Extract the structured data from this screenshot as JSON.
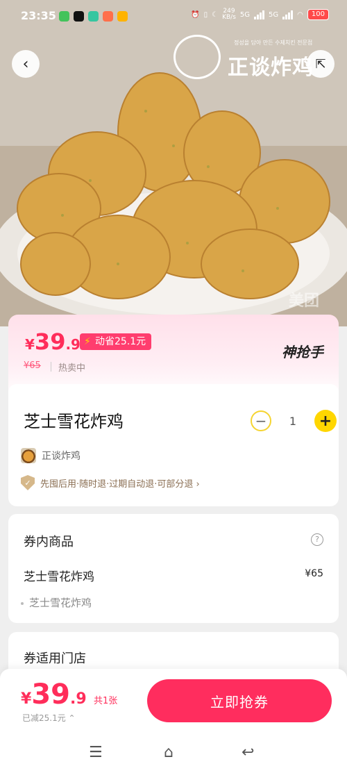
{
  "status": {
    "time": "23:35",
    "net_speed": "249",
    "net_unit": "KB/s",
    "sig1": "5G",
    "sig2": "5G",
    "battery": "100"
  },
  "header": {
    "back_icon": "chevron-left-icon",
    "share_icon": "share-icon",
    "logo_tagline": "정성을 담아 만든 수제치킨 전문점",
    "logo_name": "正谈炸鸡",
    "watermark": "美团"
  },
  "price_card": {
    "currency": "¥",
    "price_int": "39",
    "price_dec": ".9",
    "save_label": "动省25.1元",
    "original_price": "¥65",
    "status": "热卖中",
    "brand_tag": "神抢手"
  },
  "product": {
    "name": "芝士雪花炸鸡",
    "quantity": "1",
    "shop_name": "正谈炸鸡",
    "policy": "先囤后用·随时退·过期自动退·可部分退 ›"
  },
  "goods": {
    "title": "券内商品",
    "help_icon": "?",
    "item_name": "芝士雪花炸鸡",
    "item_price": "¥65",
    "sub_item": "芝士雪花炸鸡"
  },
  "store": {
    "title": "券适用门店"
  },
  "bottom": {
    "currency": "¥",
    "price_int": "39",
    "price_dec": ".9",
    "count": "共1张",
    "saved": "已减25.1元 ⌃",
    "buy_label": "立即抢券"
  },
  "colors": {
    "accent": "#ff2d5e",
    "badge": "#ff3d6e",
    "stepper": "#ffd600"
  }
}
